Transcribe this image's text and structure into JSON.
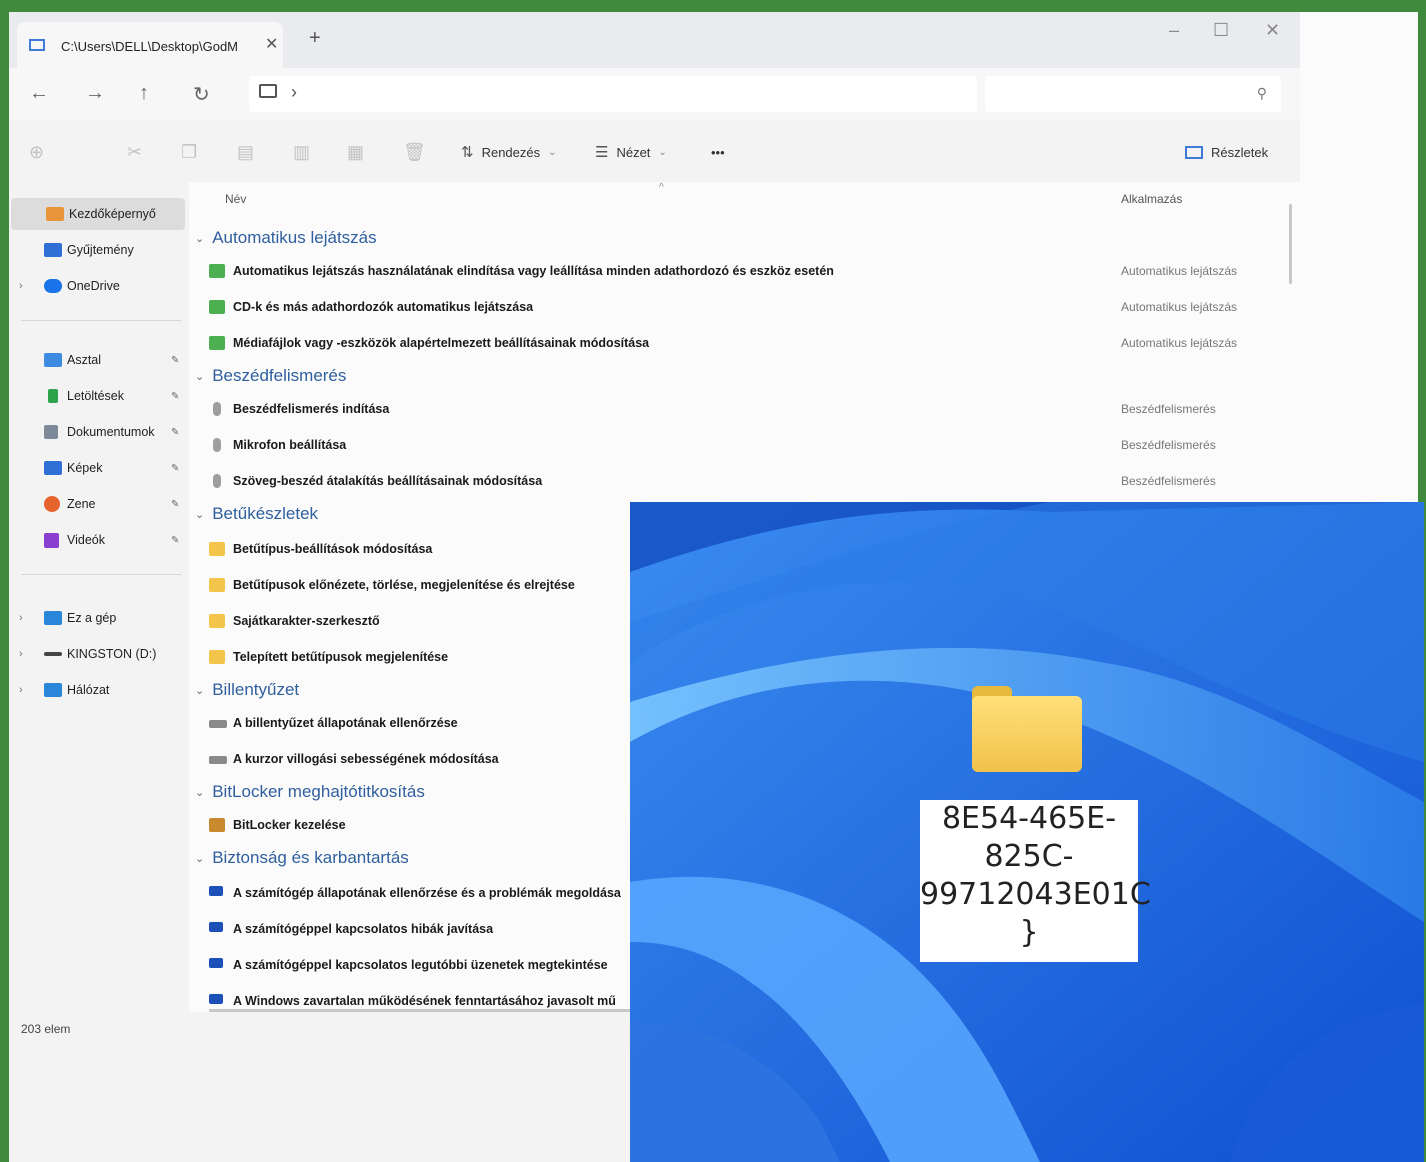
{
  "window": {
    "tab_title": "C:\\Users\\DELL\\Desktop\\GodM",
    "tab_close": "✕",
    "new_tab": "+",
    "minimize": "–",
    "maximize": "☐",
    "close": "✕"
  },
  "address": {
    "back": "←",
    "forward": "→",
    "up": "↑",
    "refresh": "↻",
    "chevron": "›",
    "search_icon": "⚲"
  },
  "toolbar": {
    "sort_label": "Rendezés",
    "view_label": "Nézet",
    "more_label": "•••",
    "details_label": "Részletek",
    "sort_glyph": "⇅",
    "view_glyph": "☰",
    "caret": "⌄"
  },
  "sidebar": {
    "items": [
      {
        "label": "Kezdőképernyő",
        "icon": "home-icon",
        "color": "#e8953a"
      },
      {
        "label": "Gyűjtemény",
        "icon": "gallery-icon",
        "color": "#2f6fd6"
      },
      {
        "label": "OneDrive",
        "icon": "cloud-icon",
        "color": "#1a73e8"
      },
      {
        "label": "Asztal",
        "icon": "desktop-icon",
        "color": "#3d8be0"
      },
      {
        "label": "Letöltések",
        "icon": "download-icon",
        "color": "#2ca24a"
      },
      {
        "label": "Dokumentumok",
        "icon": "document-icon",
        "color": "#7f8a99"
      },
      {
        "label": "Képek",
        "icon": "pictures-icon",
        "color": "#2f6fd6"
      },
      {
        "label": "Zene",
        "icon": "music-icon",
        "color": "#e5642d"
      },
      {
        "label": "Videók",
        "icon": "videos-icon",
        "color": "#8a3fd1"
      },
      {
        "label": "Ez a gép",
        "icon": "computer-icon",
        "color": "#2a86d8"
      },
      {
        "label": "KINGSTON (D:)",
        "icon": "drive-icon",
        "color": "#444444"
      },
      {
        "label": "Hálózat",
        "icon": "network-icon",
        "color": "#2a86d8"
      }
    ],
    "expander": "›",
    "pin": "📌"
  },
  "status": {
    "count": "203 elem"
  },
  "columns": {
    "name": "Név",
    "app": "Alkalmazás",
    "sort_indicator": "^"
  },
  "groups": [
    {
      "title": "Automatikus lejátszás",
      "rows": [
        {
          "name": "Automatikus lejátszás használatának elindítása vagy leállítása minden adathordozó és eszköz esetén",
          "app": "Automatikus lejátszás"
        },
        {
          "name": "CD-k és más adathordozók automatikus lejátszása",
          "app": "Automatikus lejátszás"
        },
        {
          "name": "Médiafájlok vagy -eszközök alapértelmezett beállításainak módosítása",
          "app": "Automatikus lejátszás"
        }
      ]
    },
    {
      "title": "Beszédfelismerés",
      "rows": [
        {
          "name": "Beszédfelismerés indítása",
          "app": "Beszédfelismerés"
        },
        {
          "name": "Mikrofon beállítása",
          "app": "Beszédfelismerés"
        },
        {
          "name": "Szöveg-beszéd átalakítás beállításainak módosítása",
          "app": "Beszédfelismerés"
        }
      ]
    },
    {
      "title": "Betűkészletek",
      "rows": [
        {
          "name": "Betűtípus-beállítások módosítása",
          "app": ""
        },
        {
          "name": "Betűtípusok előnézete, törlése, megjelenítése és elrejtése",
          "app": ""
        },
        {
          "name": "Sajátkarakter-szerkesztő",
          "app": ""
        },
        {
          "name": "Telepített betűtípusok megjelenítése",
          "app": ""
        }
      ]
    },
    {
      "title": "Billentyűzet",
      "rows": [
        {
          "name": "A billentyűzet állapotának ellenőrzése",
          "app": ""
        },
        {
          "name": "A kurzor villogási sebességének módosítása",
          "app": ""
        }
      ]
    },
    {
      "title": "BitLocker meghajtótitkosítás",
      "rows": [
        {
          "name": "BitLocker kezelése",
          "app": ""
        }
      ]
    },
    {
      "title": "Biztonság és karbantartás",
      "rows": [
        {
          "name": "A számítógép állapotának ellenőrzése és a problémák megoldása",
          "app": ""
        },
        {
          "name": "A számítógéppel kapcsolatos hibák javítása",
          "app": ""
        },
        {
          "name": "A számítógéppel kapcsolatos legutóbbi üzenetek megtekintése",
          "app": ""
        },
        {
          "name": "A Windows zavartalan működésének fenntartásához javasolt mű",
          "app": ""
        }
      ]
    }
  ],
  "desktop_folder": {
    "label_lines": [
      "8E54-465E-",
      "825C-",
      "99712043E01C",
      "}"
    ]
  }
}
